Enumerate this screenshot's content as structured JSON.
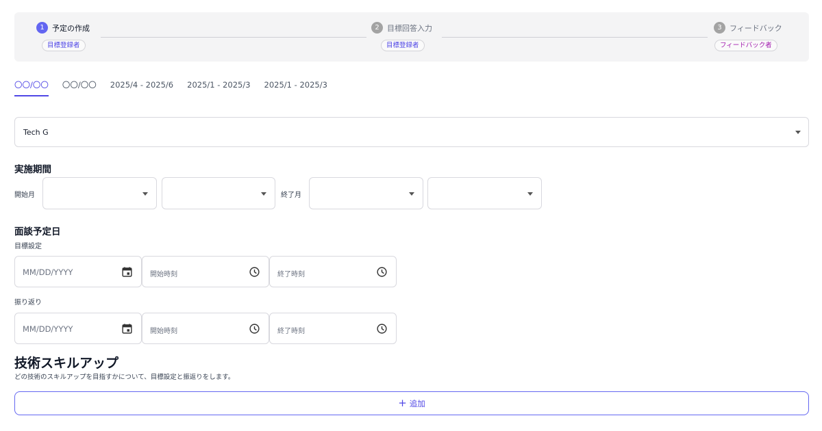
{
  "stepper": {
    "steps": [
      {
        "number": "1",
        "label": "予定の作成",
        "role": "目標登録者",
        "state": "active"
      },
      {
        "number": "2",
        "label": "目標回答入力",
        "role": "目標登録者",
        "state": "inactive"
      },
      {
        "number": "3",
        "label": "フィードバック",
        "role": "フィードバック者",
        "state": "inactive"
      }
    ]
  },
  "tabs": [
    "〇〇/〇〇",
    "〇〇/〇〇",
    "2025/4 - 2025/6",
    "2025/1 - 2025/3",
    "2025/1 - 2025/3"
  ],
  "active_tab_index": 0,
  "group_select": {
    "value": "Tech G"
  },
  "period": {
    "title": "実施期間",
    "start_label": "開始月",
    "end_label": "終了月"
  },
  "interview": {
    "title": "面談予定日",
    "goal_setting_label": "目標設定",
    "review_label": "振り返り",
    "date_placeholder": "MM/DD/YYYY",
    "start_time_placeholder": "開始時刻",
    "end_time_placeholder": "終了時刻"
  },
  "skill": {
    "title": "技術スキルアップ",
    "description": "どの技術のスキルアップを目指すかについて、目標設定と振返りをします。",
    "add_icon": "+",
    "add_label": "追加"
  },
  "colors": {
    "accent": "#6366f1",
    "accent_text": "#4f46e5",
    "role_purple": "#a21caf"
  },
  "icons": {
    "date": "calendar-icon",
    "time": "clock-icon",
    "select": "caret-down-icon"
  }
}
